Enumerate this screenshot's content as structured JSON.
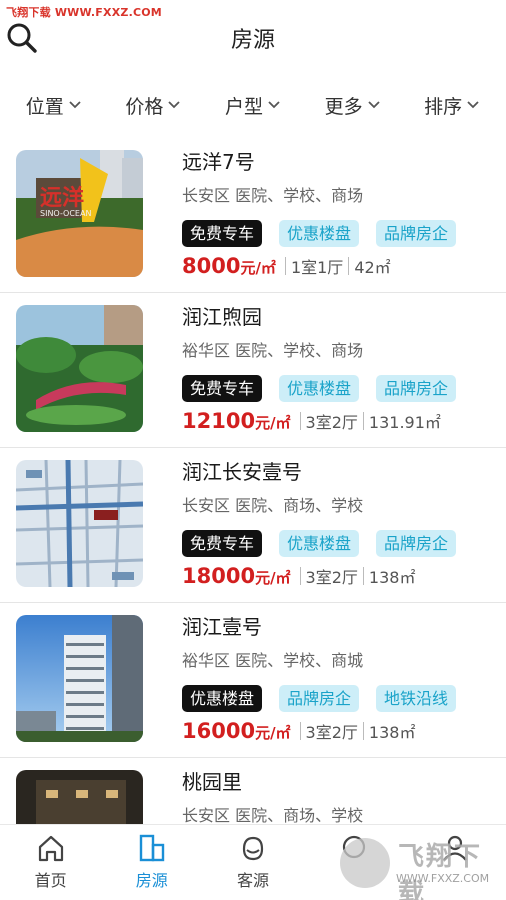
{
  "watermark": {
    "top_text": "飞翔下载 WWW.FXXZ.COM",
    "brand": "飞翔下载",
    "url": "WWW.FXXZ.COM"
  },
  "header": {
    "title": "房源",
    "search_icon": "search-icon"
  },
  "filters": [
    {
      "label": "位置"
    },
    {
      "label": "价格"
    },
    {
      "label": "户型"
    },
    {
      "label": "更多"
    },
    {
      "label": "排序"
    }
  ],
  "listings": [
    {
      "name": "远洋7号",
      "location": "长安区 医院、学校、商场",
      "tags": [
        "免费专车",
        "优惠楼盘",
        "品牌房企"
      ],
      "price": "8000",
      "price_unit": "元/㎡",
      "layout": "1室1厅",
      "area": "42㎡",
      "image_sign": "远洋",
      "image_sign_en": "SINO-OCEAN"
    },
    {
      "name": "润江煦园",
      "location": "裕华区 医院、学校、商场",
      "tags": [
        "免费专车",
        "优惠楼盘",
        "品牌房企"
      ],
      "price": "12100",
      "price_unit": "元/㎡",
      "layout": "3室2厅",
      "area": "131.91㎡"
    },
    {
      "name": "润江长安壹号",
      "location": "长安区 医院、商场、学校",
      "tags": [
        "免费专车",
        "优惠楼盘",
        "品牌房企"
      ],
      "price": "18000",
      "price_unit": "元/㎡",
      "layout": "3室2厅",
      "area": "138㎡"
    },
    {
      "name": "润江壹号",
      "location": "裕华区 医院、学校、商城",
      "tags": [
        "优惠楼盘",
        "品牌房企",
        "地铁沿线"
      ],
      "price": "16000",
      "price_unit": "元/㎡",
      "layout": "3室2厅",
      "area": "138㎡"
    },
    {
      "name": "桃园里",
      "location": "长安区 医院、商场、学校",
      "tags": [],
      "price": "",
      "price_unit": "",
      "layout": "",
      "area": ""
    }
  ],
  "tabbar": [
    {
      "label": "首页",
      "icon": "home-icon",
      "active": false
    },
    {
      "label": "房源",
      "icon": "building-icon",
      "active": true
    },
    {
      "label": "客源",
      "icon": "customer-icon",
      "active": false
    },
    {
      "label": "",
      "icon": "message-icon",
      "active": false
    },
    {
      "label": "",
      "icon": "profile-icon",
      "active": false
    }
  ],
  "colors": {
    "accent": "#1a8fd6",
    "price": "#d21f1f",
    "tag_dark": "#111111",
    "tag_light_bg": "#cdeef8",
    "tag_light_text": "#1aa3c9"
  }
}
